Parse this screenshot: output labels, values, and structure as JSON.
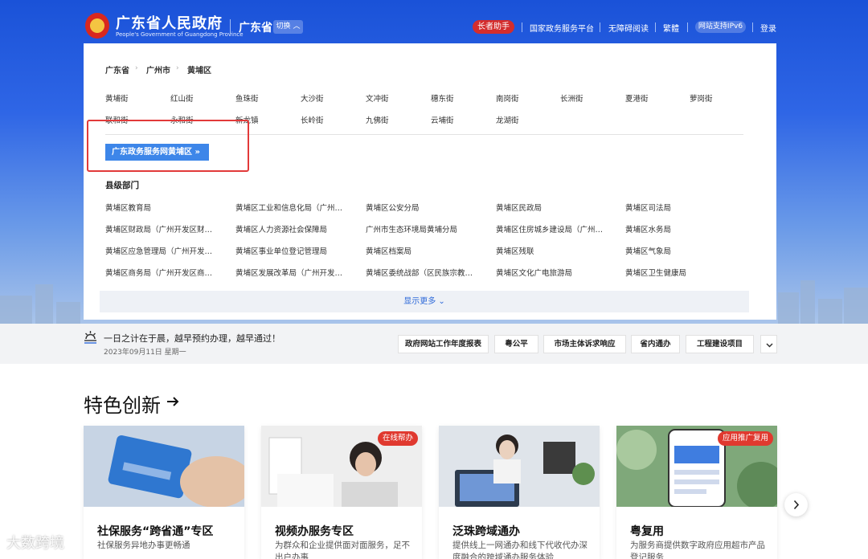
{
  "header": {
    "site_title": "广东省人民政府",
    "site_subtitle": "People's Government of Guangdong Province",
    "region": "广东省",
    "switch_label": "切换",
    "elder_mode": "长者助手",
    "links": [
      "国家政务服务平台",
      "无障碍阅读",
      "繁體",
      "网站支持IPv6",
      "登录"
    ]
  },
  "panel": {
    "breadcrumb": [
      "广东省",
      "广州市",
      "黄埔区"
    ],
    "streets_row1": [
      "黄埔街",
      "红山街",
      "鱼珠街",
      "大沙街",
      "文冲街",
      "穗东街",
      "南岗街",
      "长洲街",
      "夏港街",
      "萝岗街"
    ],
    "streets_row2": [
      "联和街",
      "永和街",
      "新龙镇",
      "长岭街",
      "九佛街",
      "云埔街",
      "龙湖街"
    ],
    "portal_button": "广东政务服务网黄埔区 »",
    "dept_title": "县级部门",
    "departments": [
      [
        "黄埔区教育局",
        "黄埔区工业和信息化局（广州开发区经济和信息化局）",
        "黄埔区公安分局",
        "黄埔区民政局",
        "黄埔区司法局"
      ],
      [
        "黄埔区财政局（广州开发区财政局）",
        "黄埔区人力资源社会保障局",
        "广州市生态环境局黄埔分局",
        "黄埔区住房城乡建设局（广州开发区建设局）",
        "黄埔区水务局"
      ],
      [
        "黄埔区应急管理局（广州开发区应急管理局）",
        "黄埔区事业单位登记管理局",
        "黄埔区档案局",
        "黄埔区残联",
        "黄埔区气象局"
      ],
      [
        "黄埔区商务局（广州开发区商务局）",
        "黄埔区发展改革局（广州开发区发展改革局）",
        "黄埔区委统战部（区民族宗教事务局）",
        "黄埔区文化广电旅游局",
        "黄埔区卫生健康局"
      ]
    ],
    "show_more": "显示更多 ⌄"
  },
  "notice": {
    "text": "一日之计在于晨，越早预约办理，越早通过！",
    "date": "2023年09月11日 星期一",
    "quick_links": [
      "政府网站工作年度报表",
      "粤公平",
      "市场主体诉求响应",
      "省内通办",
      "工程建设项目"
    ]
  },
  "features": {
    "title": "特色创新",
    "cards": [
      {
        "title": "社保服务“跨省通”专区",
        "desc": "社保服务异地办事更畅通",
        "badge": ""
      },
      {
        "title": "视频办服务专区",
        "desc": "为群众和企业提供面对面服务，足不出户办事",
        "badge": "在线帮办"
      },
      {
        "title": "泛珠跨域通办",
        "desc": "提供线上一网通办和线下代收代办深度融合的跨域通办服务体验",
        "badge": ""
      },
      {
        "title": "粤复用",
        "desc": "为服务商提供数字政府应用超市产品登记服务",
        "badge": "应用推广复用"
      }
    ]
  },
  "watermark": "大数跨境"
}
